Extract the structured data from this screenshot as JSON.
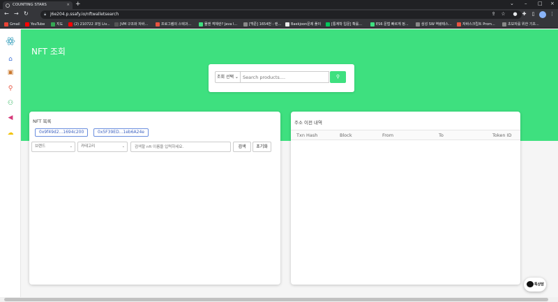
{
  "browser": {
    "tab_title": "COUNTING STARS",
    "new_tab": "+",
    "url": "j6e204.p.ssafy.io/nftwalletsearch",
    "bookmarks": [
      {
        "label": "Gmail",
        "color": "#ea4335"
      },
      {
        "label": "YouTube",
        "color": "#ff0000"
      },
      {
        "label": "지도",
        "color": "#34a853"
      },
      {
        "label": "(2) 210722 코딩 Liv...",
        "color": "#ff0000"
      },
      {
        "label": "JVM 구조와 자바...",
        "color": "#555555"
      },
      {
        "label": "프로그램의 스택과...",
        "color": "#e8533f"
      },
      {
        "label": "물엔 객체란? Java I...",
        "color": "#3ee07f"
      },
      {
        "label": "[백준] 1654번 : 랜...",
        "color": "#888888"
      },
      {
        "label": "Baekjoon문제 풀이",
        "color": "#e8e8e8"
      },
      {
        "label": "[통계학 입문] 확률...",
        "color": "#03c75a"
      },
      {
        "label": "ES6 문법 빠르게 정...",
        "color": "#3ee07f"
      },
      {
        "label": "삼성 SW 역량테스...",
        "color": "#888888"
      },
      {
        "label": "자바스크립트 Prom...",
        "color": "#e8533f"
      },
      {
        "label": "초보자를 위한 기초...",
        "color": "#888888"
      }
    ]
  },
  "sidebar": {
    "items": [
      {
        "icon": "home-icon",
        "glyph": "⌂",
        "color": "#3b6fd6"
      },
      {
        "icon": "wallet-icon",
        "glyph": "▣",
        "color": "#c9762b"
      },
      {
        "icon": "search-icon",
        "glyph": "⚲",
        "color": "#e8533f"
      },
      {
        "icon": "people-icon",
        "glyph": "⚇",
        "color": "#2bb35a"
      },
      {
        "icon": "megaphone-icon",
        "glyph": "◀",
        "color": "#d63a7a"
      },
      {
        "icon": "cloud-icon",
        "glyph": "☁",
        "color": "#f2c200"
      }
    ]
  },
  "hero": {
    "title": "NFT 조회"
  },
  "search": {
    "select_value": "조회 선택",
    "placeholder": "Search products....",
    "button_icon": "search-icon"
  },
  "nft_list": {
    "title": "NFT 목록",
    "addresses": [
      "0x9f49d2...1694c200",
      "0x5F39ED...1eb6A24e"
    ],
    "brand_select": "브랜드",
    "category_select": "카테고리",
    "name_placeholder": "검색할 nft 이름을 입력하세요.",
    "search_button": "검색",
    "reset_button": "초기화"
  },
  "history": {
    "title": "주소 이전 내역",
    "columns": [
      "Txn Hash",
      "Block",
      "From",
      "To",
      "Token ID"
    ]
  },
  "support": {
    "label": "톡상담"
  },
  "colors": {
    "brand": "#3ee07f",
    "link": "#3a5fbf"
  }
}
